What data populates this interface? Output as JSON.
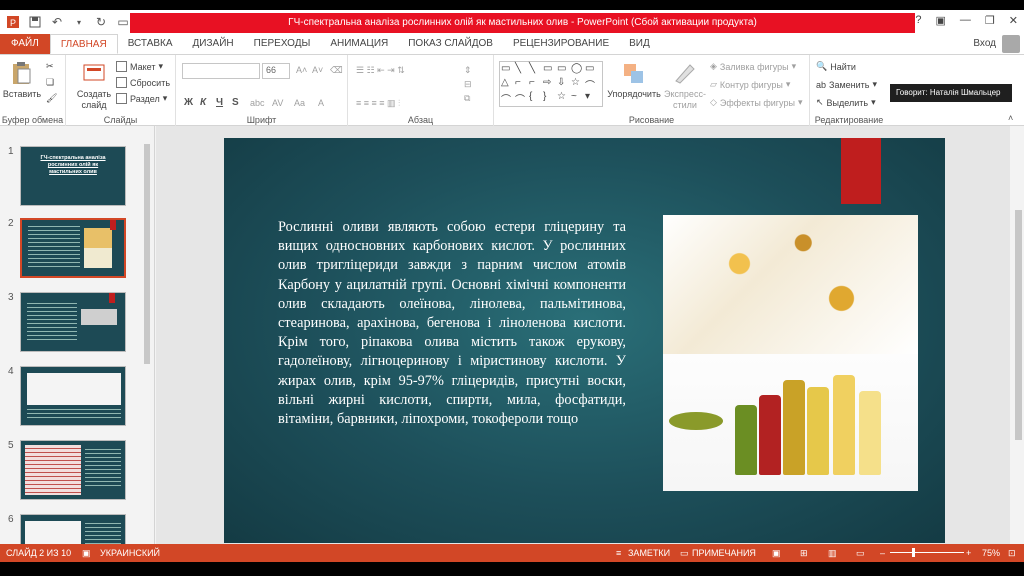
{
  "window": {
    "title": "ГЧ-спектральна аналіза рослинних олій як мастильних олив - PowerPoint (Сбой активации продукта)",
    "login": "Вход"
  },
  "tabs": [
    "ФАЙЛ",
    "ГЛАВНАЯ",
    "ВСТАВКА",
    "ДИЗАЙН",
    "ПЕРЕХОДЫ",
    "АНИМАЦИЯ",
    "ПОКАЗ СЛАЙДОВ",
    "РЕЦЕНЗИРОВАНИЕ",
    "ВИД"
  ],
  "ribbon": {
    "clipboard": {
      "paste": "Вставить",
      "group": "Буфер обмена"
    },
    "slides": {
      "create": "Создать",
      "create2": "слайд",
      "layout": "Макет",
      "reset": "Сбросить",
      "section": "Раздел",
      "group": "Слайды"
    },
    "font": {
      "size": "66",
      "group": "Шрифт"
    },
    "paragraph": {
      "group": "Абзац"
    },
    "drawing": {
      "arrange": "Упорядочить",
      "quick": "Экспресс-",
      "quick2": "стили",
      "fill": "Заливка фигуры",
      "outline": "Контур фигуры",
      "effects": "Эффекты фигуры",
      "group": "Рисование"
    },
    "editing": {
      "find": "Найти",
      "replace": "Заменить",
      "select": "Выделить",
      "group": "Редактирование"
    }
  },
  "tooltip": "Говорит: Наталія Шмальцер",
  "thumbnails": [
    {
      "num": "1",
      "title": "ГЧ-спектральна аналіза рослинних олій як мастильних олив"
    },
    {
      "num": "2"
    },
    {
      "num": "3"
    },
    {
      "num": "4"
    },
    {
      "num": "5"
    },
    {
      "num": "6"
    }
  ],
  "slide": {
    "text": "Рослинні оливи являють собою естери гліцерину та вищих односновних карбонових кислот. У рослинних олив тригліцериди завжди з парним числом атомів Карбону у ацилатній групі. Основні хімічні компоненти олив складають олеїнова, лінолева, пальмітинова, стеаринова, арахінова, бегенова і ліноленова кислоти. Крім того, ріпакова олива містить також ерукову, гадолеїнову, лігноцеринову і міристинову кислоти. У жирах олив, крім 95-97% гліцеридів, присутні воски, вільні жирні кислоти, спирти, мила, фосфатиди, вітаміни, барвники, ліпохроми, токофероли тощо"
  },
  "status": {
    "slide": "СЛАЙД 2 ИЗ 10",
    "lang": "УКРАИНСКИЙ",
    "notes": "ЗАМЕТКИ",
    "comments": "ПРИМЕЧАНИЯ",
    "zoom": "75%"
  },
  "colors": {
    "accent": "#d24726",
    "title_red": "#e81123",
    "slide_bg": "#1d4f5a"
  }
}
